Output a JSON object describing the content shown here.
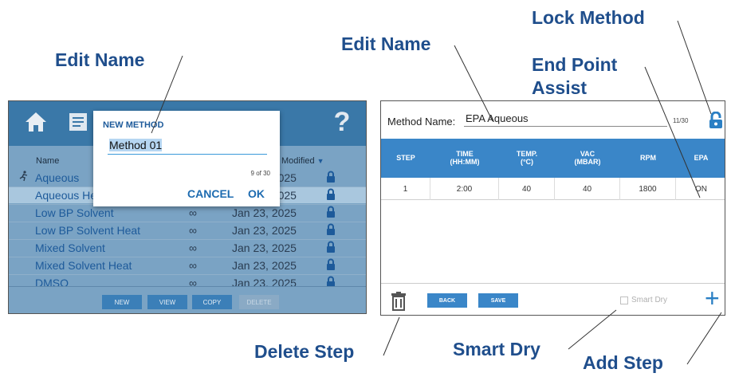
{
  "callouts": {
    "edit_name_left": "Edit Name",
    "edit_name_right": "Edit Name",
    "lock_method": "Lock Method",
    "end_point_assist_1": "End Point",
    "end_point_assist_2": "Assist",
    "delete_step": "Delete Step",
    "smart_dry": "Smart Dry",
    "add_step": "Add Step"
  },
  "colors": {
    "callout": "#1f4e8c",
    "left_bg": "#7aa3c4",
    "left_topbar": "#3a78a8",
    "accent_blue": "#3a86c8"
  },
  "left_screen": {
    "toolbar_icons": [
      "home-icon",
      "method-list-icon",
      "settings-icon",
      "gauge-icon",
      "help-icon"
    ],
    "help_glyph": "?",
    "columns": {
      "name": "Name",
      "modified": "Modified"
    },
    "rows": [
      {
        "name": "Aqueous",
        "duration": "∞",
        "date": "Jan 23, 2025",
        "running": true
      },
      {
        "name": "Aqueous Heat",
        "duration": "∞",
        "date": "Jan 23, 2025",
        "selected": true
      },
      {
        "name": "Low BP Solvent",
        "duration": "∞",
        "date": "Jan 23, 2025"
      },
      {
        "name": "Low BP Solvent Heat",
        "duration": "∞",
        "date": "Jan 23, 2025"
      },
      {
        "name": "Mixed Solvent",
        "duration": "∞",
        "date": "Jan 23, 2025"
      },
      {
        "name": "Mixed Solvent Heat",
        "duration": "∞",
        "date": "Jan 23, 2025"
      },
      {
        "name": "DMSO",
        "duration": "∞",
        "date": "Jan 23, 2025"
      }
    ],
    "buttons": {
      "new": "NEW",
      "view": "VIEW",
      "copy": "COPY",
      "delete": "DELETE"
    },
    "dialog": {
      "title": "NEW METHOD",
      "value": "Method 01",
      "count": "9 of 30",
      "cancel": "CANCEL",
      "ok": "OK"
    }
  },
  "right_screen": {
    "method_label": "Method Name:",
    "method_name": "EPA Aqueous",
    "char_count": "11/30",
    "headers": {
      "step": "STEP",
      "time": "TIME\n(HH:MM)",
      "temp": "TEMP.\n(°C)",
      "vac": "VAC\n(MBAR)",
      "rpm": "RPM",
      "epa": "EPA"
    },
    "rows": [
      {
        "step": "1",
        "time": "2:00",
        "temp": "40",
        "vac": "40",
        "rpm": "1800",
        "epa": "ON"
      }
    ],
    "buttons": {
      "back": "BACK",
      "save": "SAVE",
      "add": "+"
    },
    "smart_dry": "Smart Dry"
  }
}
